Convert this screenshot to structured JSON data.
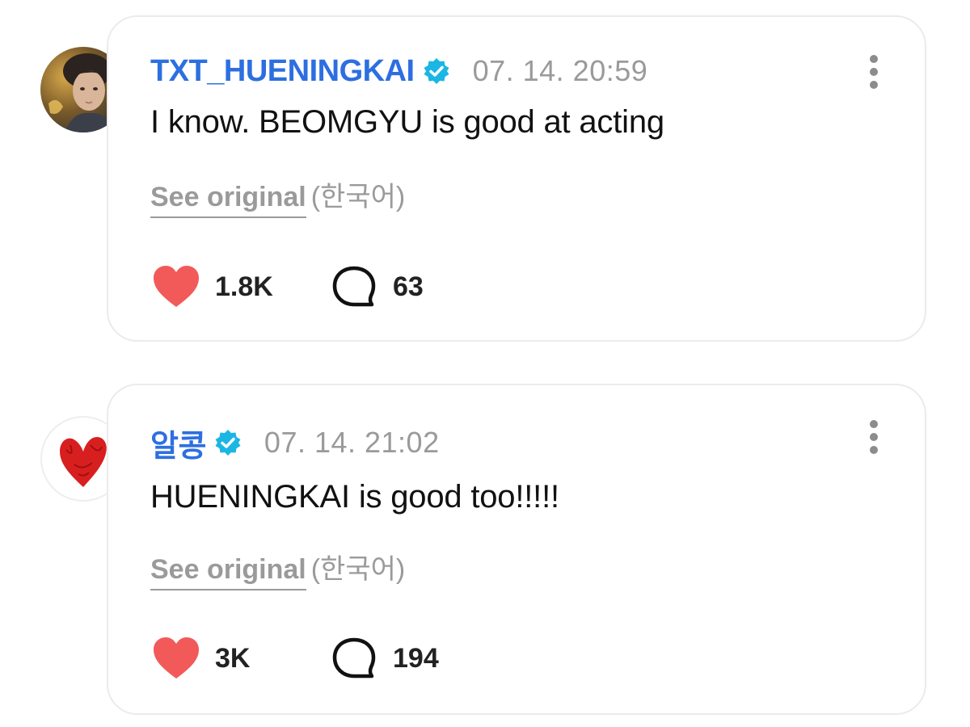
{
  "comments": [
    {
      "username": "TXT_HUENINGKAI",
      "timestamp": "07. 14. 20:59",
      "text": "I know. BEOMGYU is good at acting",
      "see_original": "See original",
      "original_language": "(한국어)",
      "likes": "1.8K",
      "replies": "63",
      "verified": true
    },
    {
      "username": "알콩",
      "timestamp": "07. 14. 21:02",
      "text": "HUENINGKAI is good too!!!!!",
      "see_original": "See original",
      "original_language": "(한국어)",
      "likes": "3K",
      "replies": "194",
      "verified": true
    }
  ],
  "icons": {
    "verified": "verified-badge-icon",
    "like": "heart-icon",
    "reply": "speech-bubble-icon",
    "more": "more-options-icon"
  },
  "colors": {
    "username": "#2d6fe0",
    "verified": "#1bb6e4",
    "heart": "#f25a5a",
    "timestamp": "#9a9a9a",
    "text": "#111111"
  }
}
